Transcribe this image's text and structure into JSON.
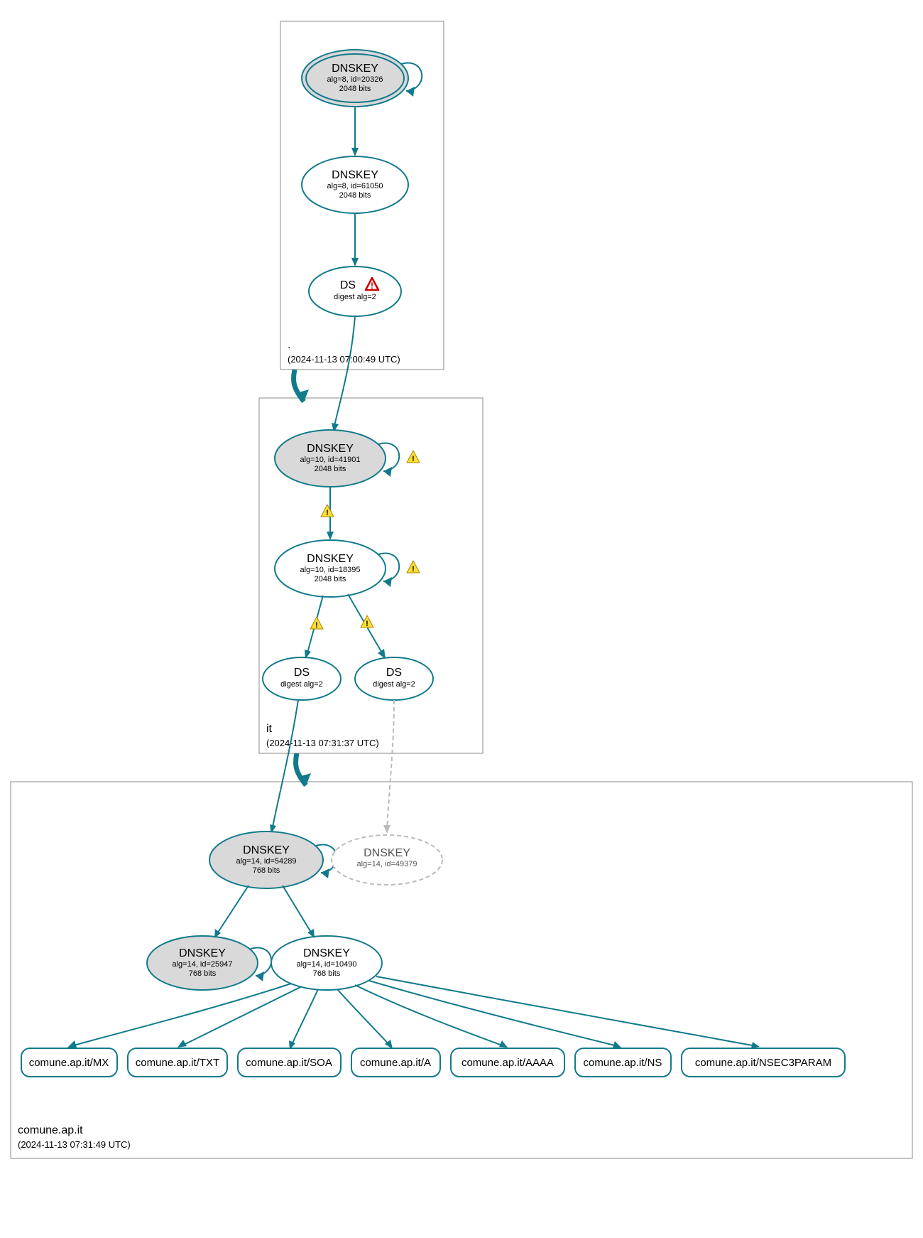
{
  "chart_data": {
    "type": "tree",
    "zones": [
      {
        "id": "root",
        "name": ".",
        "timestamp": "(2024-11-13 07:00:49 UTC)"
      },
      {
        "id": "it",
        "name": "it",
        "timestamp": "(2024-11-13 07:31:37 UTC)"
      },
      {
        "id": "comune",
        "name": "comune.ap.it",
        "timestamp": "(2024-11-13 07:31:49 UTC)"
      }
    ],
    "nodes": [
      {
        "id": "root-ksk",
        "zone": "root",
        "type": "DNSKEY",
        "title": "DNSKEY",
        "line2": "alg=8, id=20326",
        "line3": "2048 bits",
        "style": "filled-double",
        "selfloop": true,
        "warning": null
      },
      {
        "id": "root-zsk",
        "zone": "root",
        "type": "DNSKEY",
        "title": "DNSKEY",
        "line2": "alg=8, id=61050",
        "line3": "2048 bits",
        "style": "white",
        "selfloop": false,
        "warning": null
      },
      {
        "id": "root-ds",
        "zone": "root",
        "type": "DS",
        "title": "DS",
        "line2": "digest alg=2",
        "line3": "",
        "style": "white",
        "selfloop": false,
        "warning": "error-inline"
      },
      {
        "id": "it-ksk",
        "zone": "it",
        "type": "DNSKEY",
        "title": "DNSKEY",
        "line2": "alg=10, id=41901",
        "line3": "2048 bits",
        "style": "filled",
        "selfloop": true,
        "warning": "warn-right"
      },
      {
        "id": "it-zsk",
        "zone": "it",
        "type": "DNSKEY",
        "title": "DNSKEY",
        "line2": "alg=10, id=18395",
        "line3": "2048 bits",
        "style": "white",
        "selfloop": true,
        "warning": "warn-right"
      },
      {
        "id": "it-ds1",
        "zone": "it",
        "type": "DS",
        "title": "DS",
        "line2": "digest alg=2",
        "line3": "",
        "style": "white",
        "selfloop": false,
        "warning": null
      },
      {
        "id": "it-ds2",
        "zone": "it",
        "type": "DS",
        "title": "DS",
        "line2": "digest alg=2",
        "line3": "",
        "style": "white",
        "selfloop": false,
        "warning": null
      },
      {
        "id": "com-ksk",
        "zone": "comune",
        "type": "DNSKEY",
        "title": "DNSKEY",
        "line2": "alg=14, id=54289",
        "line3": "768 bits",
        "style": "filled",
        "selfloop": true,
        "warning": null
      },
      {
        "id": "com-ghost",
        "zone": "comune",
        "type": "DNSKEY",
        "title": "DNSKEY",
        "line2": "alg=14, id=49379",
        "line3": "",
        "style": "dashed",
        "selfloop": false,
        "warning": null
      },
      {
        "id": "com-zsk2",
        "zone": "comune",
        "type": "DNSKEY",
        "title": "DNSKEY",
        "line2": "alg=14, id=25947",
        "line3": "768 bits",
        "style": "filled",
        "selfloop": true,
        "warning": null
      },
      {
        "id": "com-zsk1",
        "zone": "comune",
        "type": "DNSKEY",
        "title": "DNSKEY",
        "line2": "alg=14, id=10490",
        "line3": "768 bits",
        "style": "white",
        "selfloop": false,
        "warning": null
      }
    ],
    "leaves": [
      {
        "id": "leaf-mx",
        "label": "comune.ap.it/MX"
      },
      {
        "id": "leaf-txt",
        "label": "comune.ap.it/TXT"
      },
      {
        "id": "leaf-soa",
        "label": "comune.ap.it/SOA"
      },
      {
        "id": "leaf-a",
        "label": "comune.ap.it/A"
      },
      {
        "id": "leaf-aaaa",
        "label": "comune.ap.it/AAAA"
      },
      {
        "id": "leaf-ns",
        "label": "comune.ap.it/NS"
      },
      {
        "id": "leaf-nsec",
        "label": "comune.ap.it/NSEC3PARAM"
      }
    ],
    "edges": [
      {
        "from": "root-ksk",
        "to": "root-zsk",
        "style": "solid",
        "warning": null
      },
      {
        "from": "root-zsk",
        "to": "root-ds",
        "style": "solid",
        "warning": null
      },
      {
        "from": "root-ds",
        "to": "it-ksk",
        "style": "solid",
        "warning": null
      },
      {
        "from": "root",
        "to": "it",
        "style": "solid-thick",
        "warning": null
      },
      {
        "from": "it-ksk",
        "to": "it-zsk",
        "style": "solid",
        "warning": "warn"
      },
      {
        "from": "it-zsk",
        "to": "it-ds1",
        "style": "solid",
        "warning": "warn"
      },
      {
        "from": "it-zsk",
        "to": "it-ds2",
        "style": "solid",
        "warning": "warn"
      },
      {
        "from": "it-ds1",
        "to": "com-ksk",
        "style": "solid",
        "warning": null
      },
      {
        "from": "it-ds2",
        "to": "com-ghost",
        "style": "dashed",
        "warning": null
      },
      {
        "from": "it",
        "to": "comune",
        "style": "solid-thick",
        "warning": null
      },
      {
        "from": "com-ksk",
        "to": "com-zsk2",
        "style": "solid",
        "warning": null
      },
      {
        "from": "com-ksk",
        "to": "com-zsk1",
        "style": "solid",
        "warning": null
      },
      {
        "from": "com-zsk1",
        "to": "leaf-mx",
        "style": "solid",
        "warning": null
      },
      {
        "from": "com-zsk1",
        "to": "leaf-txt",
        "style": "solid",
        "warning": null
      },
      {
        "from": "com-zsk1",
        "to": "leaf-soa",
        "style": "solid",
        "warning": null
      },
      {
        "from": "com-zsk1",
        "to": "leaf-a",
        "style": "solid",
        "warning": null
      },
      {
        "from": "com-zsk1",
        "to": "leaf-aaaa",
        "style": "solid",
        "warning": null
      },
      {
        "from": "com-zsk1",
        "to": "leaf-ns",
        "style": "solid",
        "warning": null
      },
      {
        "from": "com-zsk1",
        "to": "leaf-nsec",
        "style": "solid",
        "warning": null
      }
    ]
  }
}
